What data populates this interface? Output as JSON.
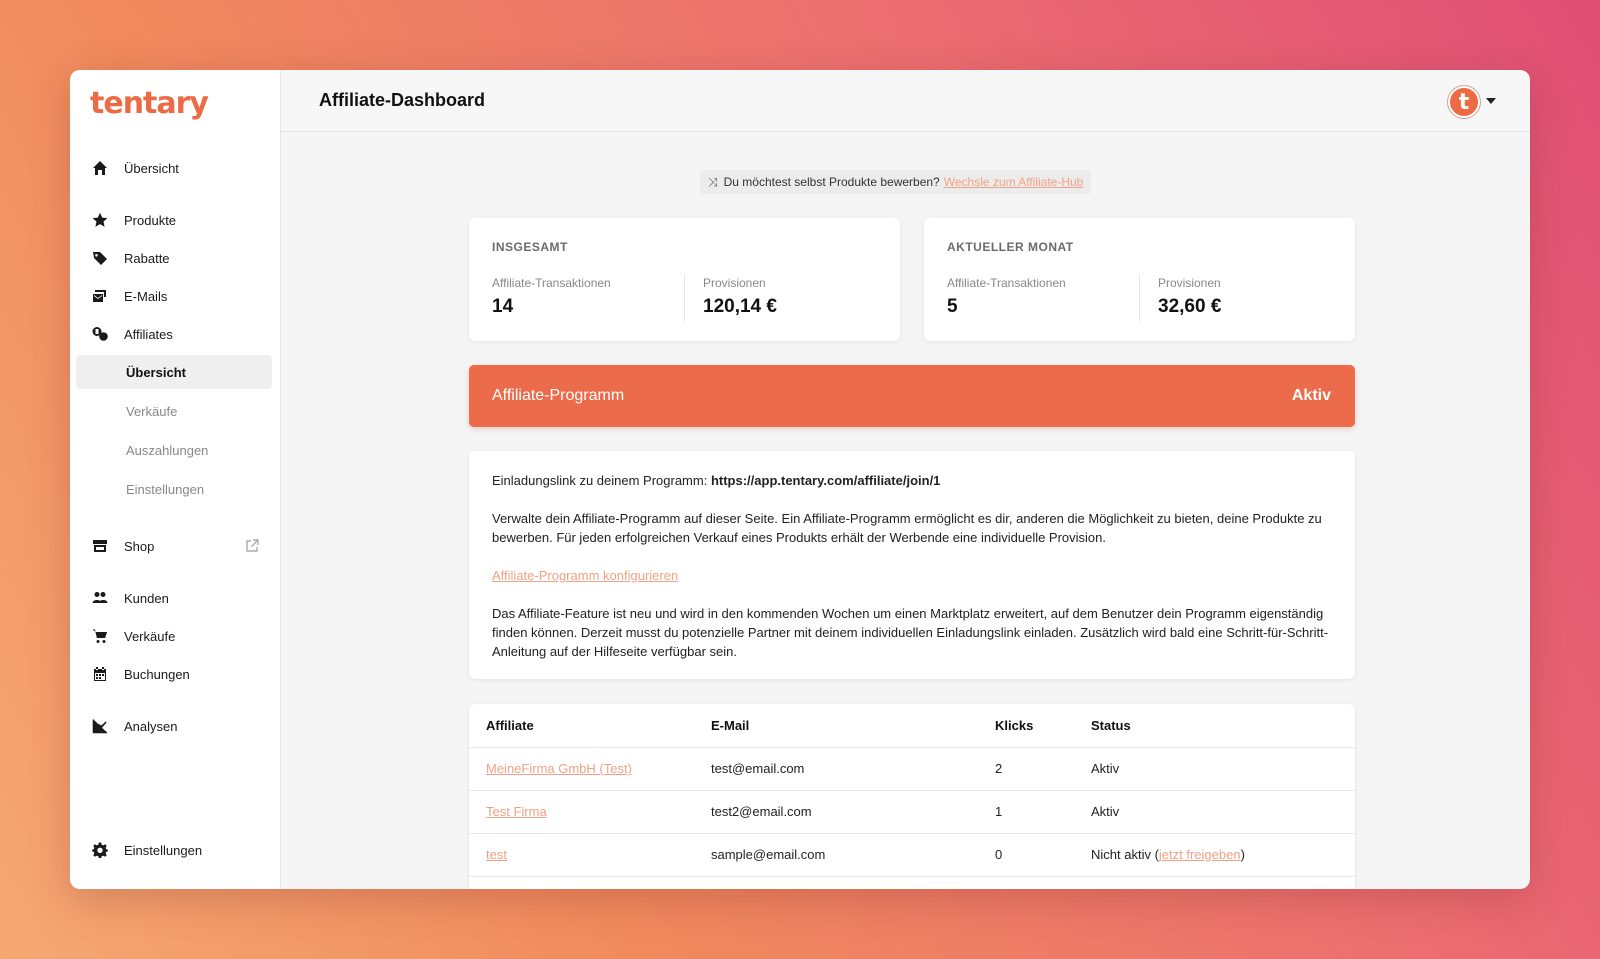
{
  "app": {
    "logo": "tentary"
  },
  "sidebar": {
    "items": [
      {
        "label": "Übersicht",
        "icon": "home-icon"
      },
      {
        "label": "Produkte",
        "icon": "star-icon"
      },
      {
        "label": "Rabatte",
        "icon": "tag-icon"
      },
      {
        "label": "E-Mails",
        "icon": "mail-icon"
      },
      {
        "label": "Affiliates",
        "icon": "affiliates-icon"
      }
    ],
    "affiliate_sub": [
      {
        "label": "Übersicht",
        "active": true
      },
      {
        "label": "Verkäufe"
      },
      {
        "label": "Auszahlungen"
      },
      {
        "label": "Einstellungen"
      }
    ],
    "shop": {
      "label": "Shop",
      "icon": "store-icon"
    },
    "items2": [
      {
        "label": "Kunden",
        "icon": "users-icon"
      },
      {
        "label": "Verkäufe",
        "icon": "cart-icon"
      },
      {
        "label": "Buchungen",
        "icon": "calendar-icon"
      }
    ],
    "analysen": {
      "label": "Analysen",
      "icon": "chart-icon"
    },
    "settings": {
      "label": "Einstellungen",
      "icon": "gear-icon"
    }
  },
  "header": {
    "title": "Affiliate-Dashboard",
    "avatar_letter": "t"
  },
  "hint": {
    "text": "Du möchtest selbst Produkte bewerben?",
    "link": "Wechsle zum Affiliate-Hub"
  },
  "stats": {
    "total": {
      "heading": "INSGESAMT",
      "transactions_label": "Affiliate-Transaktionen",
      "transactions_value": "14",
      "commission_label": "Provisionen",
      "commission_value": "120,14 €"
    },
    "month": {
      "heading": "AKTUELLER MONAT",
      "transactions_label": "Affiliate-Transaktionen",
      "transactions_value": "5",
      "commission_label": "Provisionen",
      "commission_value": "32,60 €"
    }
  },
  "program": {
    "title": "Affiliate-Programm",
    "status": "Aktiv"
  },
  "info": {
    "invite_label": "Einladungslink zu deinem Programm:",
    "invite_url": "https://app.tentary.com/affiliate/join/1",
    "paragraph1": "Verwalte dein Affiliate-Programm auf dieser Seite. Ein Affiliate-Programm ermöglicht es dir, anderen die Möglichkeit zu bieten, deine Produkte zu bewerben. Für jeden erfolgreichen Verkauf eines Produkts erhält der Werbende eine individuelle Provision.",
    "configure_link": "Affiliate-Programm konfigurieren",
    "paragraph2": "Das Affiliate-Feature ist neu und wird in den kommenden Wochen um einen Marktplatz erweitert, auf dem Benutzer dein Programm eigenständig finden können. Derzeit musst du potenzielle Partner mit deinem individuellen Einladungslink einladen. Zusätzlich wird bald eine Schritt-für-Schritt-Anleitung auf der Hilfeseite verfügbar sein."
  },
  "table": {
    "headers": [
      "Affiliate",
      "E-Mail",
      "Klicks",
      "Status"
    ],
    "rows": [
      {
        "name": "MeineFirma GmbH (Test)",
        "email": "test@email.com",
        "clicks": "2",
        "status": "Aktiv"
      },
      {
        "name": "Test Firma",
        "email": "test2@email.com",
        "clicks": "1",
        "status": "Aktiv"
      },
      {
        "name": "test",
        "email": "sample@email.com",
        "clicks": "0",
        "status": "Nicht aktiv (",
        "status_link": "jetzt freigeben",
        "status_end": ")"
      }
    ]
  },
  "colors": {
    "accent": "#ec6b4b",
    "link": "#f0a285"
  }
}
